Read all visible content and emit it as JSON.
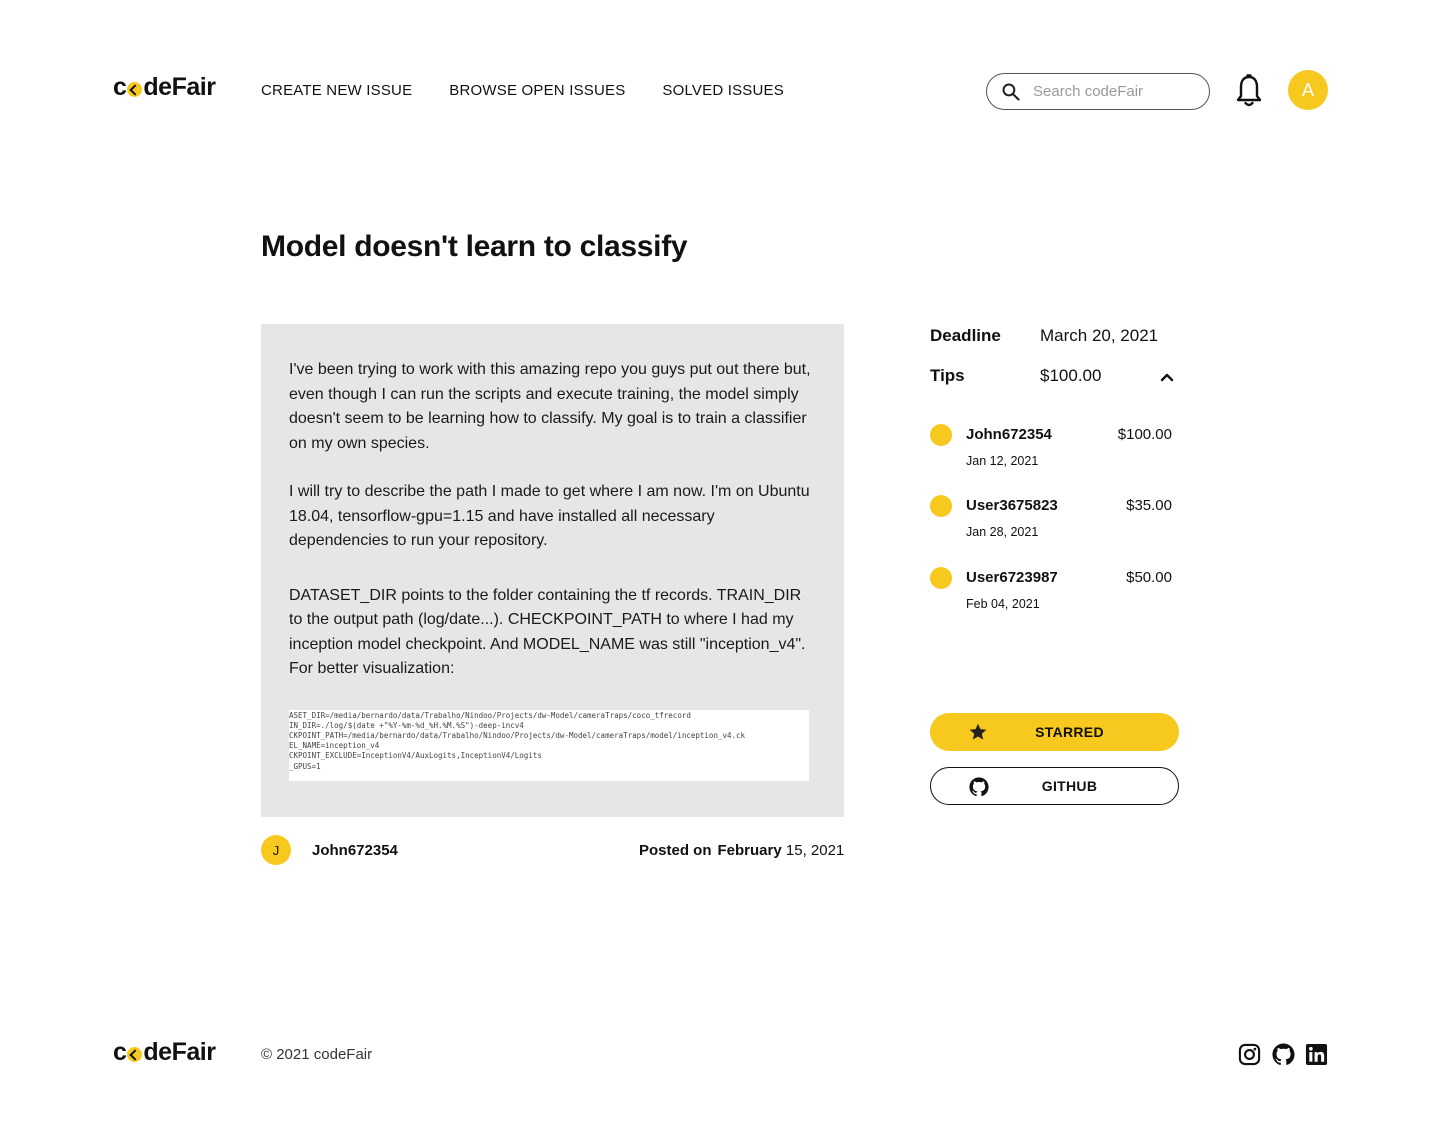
{
  "header": {
    "logo": {
      "pre": "c",
      "post": "deFair"
    },
    "nav": [
      "CREATE NEW ISSUE",
      "BROWSE OPEN ISSUES",
      "SOLVED ISSUES"
    ],
    "search_placeholder": "Search codeFair",
    "avatar_initial": "A"
  },
  "issue": {
    "title": "Model doesn't learn to classify",
    "paragraphs": [
      "I've been trying to work with this amazing repo you guys put out there but, even though I can run the scripts and execute training, the model simply doesn't seem to be learning how to classify. My goal is to train a classifier on my own species.",
      "I will try to describe the path I made to get where I am now. I'm on Ubuntu 18.04, tensorflow-gpu=1.15 and have installed all necessary dependencies to run your repository.",
      "DATASET_DIR points to the folder containing the tf records. TRAIN_DIR to the output path (log/date...). CHECKPOINT_PATH to where I had my inception model checkpoint. And MODEL_NAME was still \"inception_v4\". For better visualization:"
    ],
    "code_lines": [
      "ASET_DIR=/media/bernardo/data/Trabalho/Nindoo/Projects/dw-Model/cameraTraps/coco_tfrecord",
      "IN_DIR=./log/$(date +\"%Y-%m-%d_%H.%M.%S\")-deep-incv4",
      "CKPOINT_PATH=/media/bernardo/data/Trabalho/Nindoo/Projects/dw-Model/cameraTraps/model/inception_v4.ck",
      "EL_NAME=inception_v4",
      "CKPOINT_EXCLUDE=InceptionV4/AuxLogits,InceptionV4/Logits",
      "_GPUS=1"
    ],
    "author": {
      "initial": "J",
      "name": "John672354"
    },
    "posted": {
      "label": "Posted on",
      "month": "February",
      "rest": "15, 2021"
    }
  },
  "sidebar": {
    "deadline_label": "Deadline",
    "deadline_value": "March 20, 2021",
    "tips_label": "Tips",
    "tips_value": "$100.00",
    "tips": [
      {
        "user": "John672354",
        "amount": "$100.00",
        "date": "Jan 12, 2021"
      },
      {
        "user": "User3675823",
        "amount": "$35.00",
        "date": "Jan 28, 2021"
      },
      {
        "user": "User6723987",
        "amount": "$50.00",
        "date": "Feb 04, 2021"
      }
    ],
    "starred_label": "STARRED",
    "github_label": "GITHUB"
  },
  "footer": {
    "copyright": "© 2021 codeFair"
  },
  "colors": {
    "accent": "#f7c91e",
    "card": "#e6e6e6"
  }
}
